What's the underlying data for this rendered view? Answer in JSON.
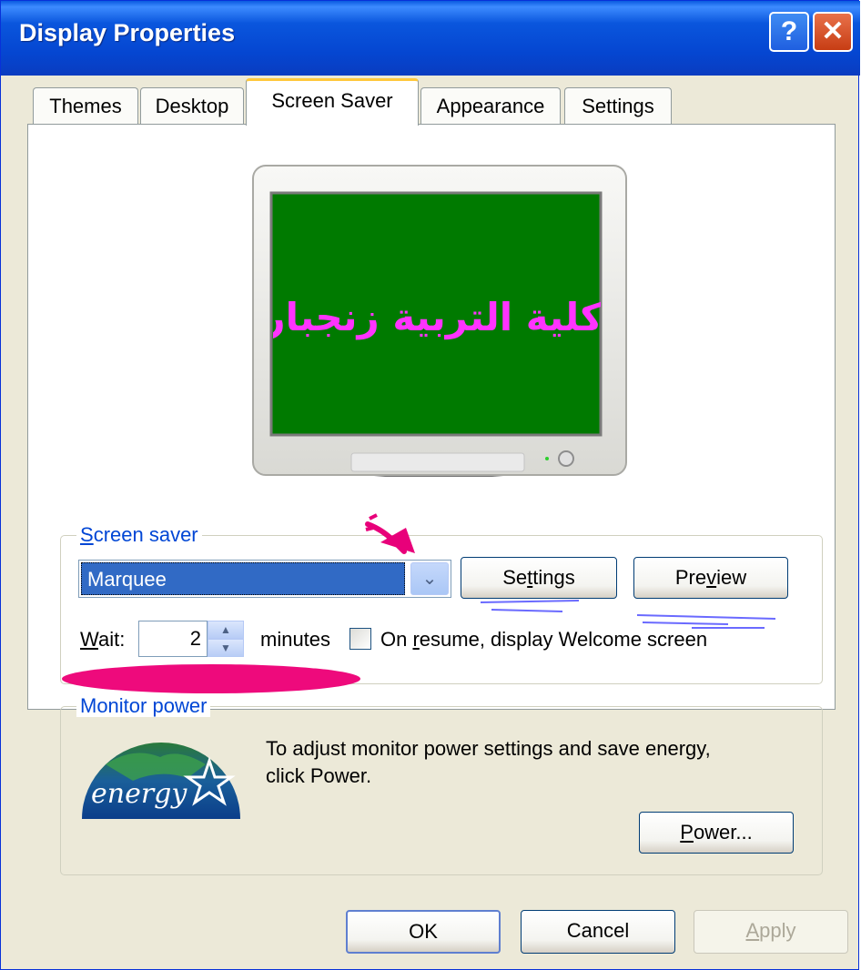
{
  "window": {
    "title": "Display Properties",
    "help_glyph": "?",
    "close_glyph": "✕"
  },
  "tabs": [
    {
      "label": "Themes"
    },
    {
      "label": "Desktop"
    },
    {
      "label": "Screen Saver",
      "active": true
    },
    {
      "label": "Appearance"
    },
    {
      "label": "Settings"
    }
  ],
  "preview": {
    "marquee_text": "كلية التربية زنجبار",
    "screen_color": "#007a00",
    "text_color": "#ff33ff"
  },
  "screensaver": {
    "group_label_access": "S",
    "group_label_rest": "creen saver",
    "selected": "Marquee",
    "settings_pre": "Se",
    "settings_key": "t",
    "settings_post": "tings",
    "preview_pre": "Pre",
    "preview_key": "v",
    "preview_post": "iew",
    "wait_key": "W",
    "wait_rest": "ait:",
    "wait_value": "2",
    "minutes_label": "minutes",
    "resume_pre": "On ",
    "resume_key": "r",
    "resume_post": "esume, display Welcome screen",
    "resume_checked": false
  },
  "monitor_power": {
    "group_label": "Monitor power",
    "description_line1": "To adjust monitor power settings and save energy,",
    "description_line2": "click Power.",
    "power_key": "P",
    "power_rest": "ower...",
    "logo_text": "energy"
  },
  "footer": {
    "ok_label": "OK",
    "cancel_label": "Cancel",
    "apply_key": "A",
    "apply_rest": "pply"
  },
  "annotations": {
    "arrow_color": "#e8007a",
    "ellipse_color": "#ee0a7c",
    "underline_color": "#6a6aff"
  }
}
